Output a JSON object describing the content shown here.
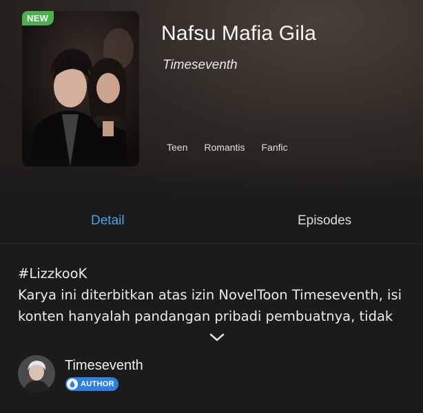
{
  "book": {
    "badge": "NEW",
    "title": "Nafsu Mafia Gila",
    "author": "Timeseventh",
    "tags": [
      "Teen",
      "Romantis",
      "Fanfic"
    ]
  },
  "tabs": [
    {
      "label": "Detail",
      "active": true
    },
    {
      "label": "Episodes",
      "active": false
    }
  ],
  "description": {
    "lines": [
      "#LizzkooK",
      "Karya ini diterbitkan atas izin NovelToon Timeseventh, isi",
      "konten hanyalah pandangan pribadi pembuatnya, tidak"
    ],
    "expand_icon": "chevron-down-icon"
  },
  "author_profile": {
    "name": "Timeseventh",
    "badge_label": "AUTHOR",
    "badge_icon": "drop-icon"
  },
  "colors": {
    "accent": "#4aa3e8",
    "new_badge": "#4caf50",
    "author_badge": "#2f7fe0",
    "background": "#1b1b1b"
  }
}
